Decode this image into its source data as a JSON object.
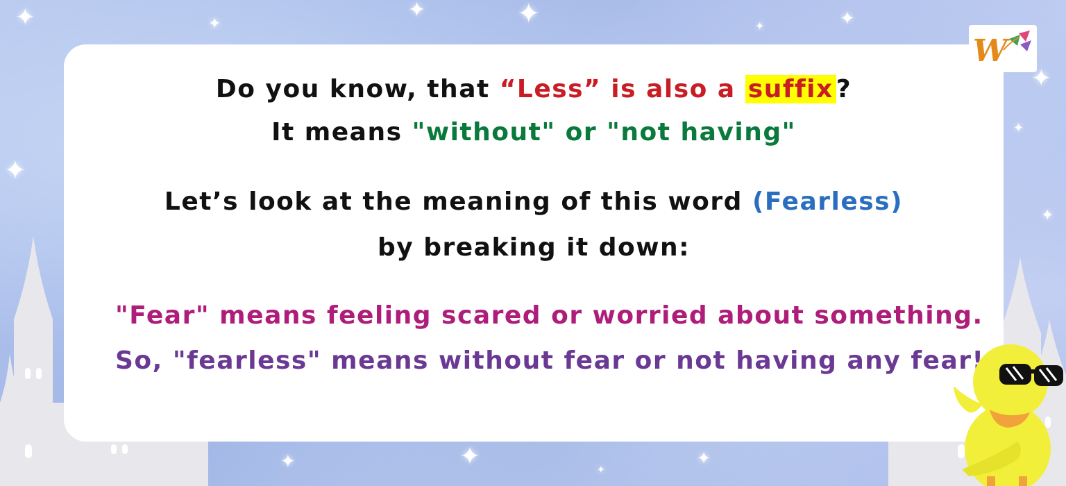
{
  "content": {
    "line1": {
      "part1": "Do you know, that ",
      "highlight_word": "“Less” is also a ",
      "highlighted": "suffix",
      "end": "?"
    },
    "line2": {
      "part1": "It means ",
      "green": "\"without\" or \"not having\""
    },
    "line3": {
      "part1": "Let’s look at the meaning of this word ",
      "blue": "(Fearless)"
    },
    "line4": "by breaking it down:",
    "bullets": [
      "\"Fear\" means feeling scared or worried about something.",
      "So, \"fearless\" means without fear or not having any fear!"
    ]
  },
  "logo": {
    "letter": "W"
  },
  "colors": {
    "red": "#c81d25",
    "highlight": "#ffff00",
    "green": "#0a7a3c",
    "blue": "#2a6fbf",
    "bullet1": "#ad1d79",
    "bullet2": "#6a3993"
  },
  "icons": [
    "logo-icon",
    "duck-mascot-icon",
    "star-icon",
    "castle-silhouette-icon"
  ]
}
